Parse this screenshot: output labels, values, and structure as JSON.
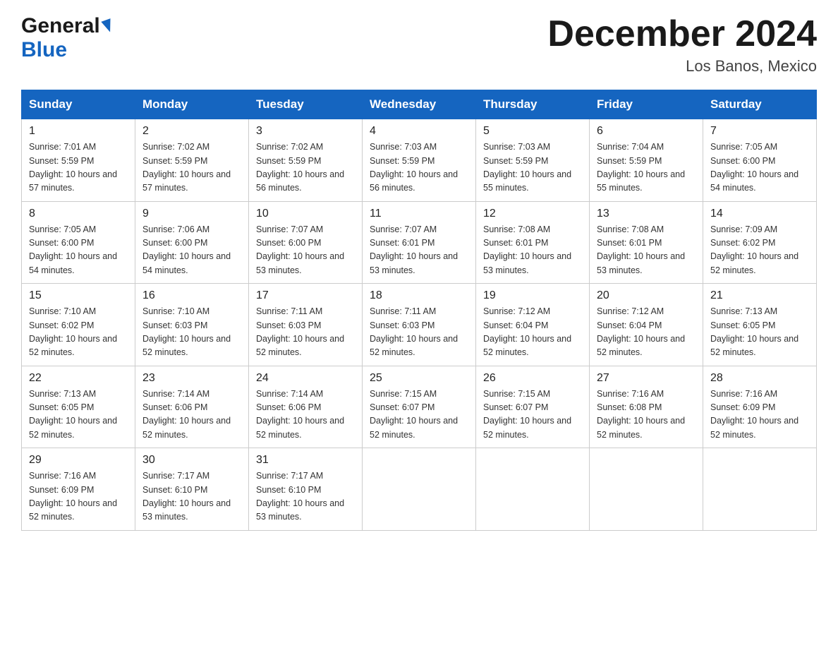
{
  "header": {
    "title": "December 2024",
    "location": "Los Banos, Mexico",
    "logo_general": "General",
    "logo_blue": "Blue"
  },
  "days_of_week": [
    "Sunday",
    "Monday",
    "Tuesday",
    "Wednesday",
    "Thursday",
    "Friday",
    "Saturday"
  ],
  "weeks": [
    [
      {
        "day": "1",
        "sunrise": "7:01 AM",
        "sunset": "5:59 PM",
        "daylight": "10 hours and 57 minutes."
      },
      {
        "day": "2",
        "sunrise": "7:02 AM",
        "sunset": "5:59 PM",
        "daylight": "10 hours and 57 minutes."
      },
      {
        "day": "3",
        "sunrise": "7:02 AM",
        "sunset": "5:59 PM",
        "daylight": "10 hours and 56 minutes."
      },
      {
        "day": "4",
        "sunrise": "7:03 AM",
        "sunset": "5:59 PM",
        "daylight": "10 hours and 56 minutes."
      },
      {
        "day": "5",
        "sunrise": "7:03 AM",
        "sunset": "5:59 PM",
        "daylight": "10 hours and 55 minutes."
      },
      {
        "day": "6",
        "sunrise": "7:04 AM",
        "sunset": "5:59 PM",
        "daylight": "10 hours and 55 minutes."
      },
      {
        "day": "7",
        "sunrise": "7:05 AM",
        "sunset": "6:00 PM",
        "daylight": "10 hours and 54 minutes."
      }
    ],
    [
      {
        "day": "8",
        "sunrise": "7:05 AM",
        "sunset": "6:00 PM",
        "daylight": "10 hours and 54 minutes."
      },
      {
        "day": "9",
        "sunrise": "7:06 AM",
        "sunset": "6:00 PM",
        "daylight": "10 hours and 54 minutes."
      },
      {
        "day": "10",
        "sunrise": "7:07 AM",
        "sunset": "6:00 PM",
        "daylight": "10 hours and 53 minutes."
      },
      {
        "day": "11",
        "sunrise": "7:07 AM",
        "sunset": "6:01 PM",
        "daylight": "10 hours and 53 minutes."
      },
      {
        "day": "12",
        "sunrise": "7:08 AM",
        "sunset": "6:01 PM",
        "daylight": "10 hours and 53 minutes."
      },
      {
        "day": "13",
        "sunrise": "7:08 AM",
        "sunset": "6:01 PM",
        "daylight": "10 hours and 53 minutes."
      },
      {
        "day": "14",
        "sunrise": "7:09 AM",
        "sunset": "6:02 PM",
        "daylight": "10 hours and 52 minutes."
      }
    ],
    [
      {
        "day": "15",
        "sunrise": "7:10 AM",
        "sunset": "6:02 PM",
        "daylight": "10 hours and 52 minutes."
      },
      {
        "day": "16",
        "sunrise": "7:10 AM",
        "sunset": "6:03 PM",
        "daylight": "10 hours and 52 minutes."
      },
      {
        "day": "17",
        "sunrise": "7:11 AM",
        "sunset": "6:03 PM",
        "daylight": "10 hours and 52 minutes."
      },
      {
        "day": "18",
        "sunrise": "7:11 AM",
        "sunset": "6:03 PM",
        "daylight": "10 hours and 52 minutes."
      },
      {
        "day": "19",
        "sunrise": "7:12 AM",
        "sunset": "6:04 PM",
        "daylight": "10 hours and 52 minutes."
      },
      {
        "day": "20",
        "sunrise": "7:12 AM",
        "sunset": "6:04 PM",
        "daylight": "10 hours and 52 minutes."
      },
      {
        "day": "21",
        "sunrise": "7:13 AM",
        "sunset": "6:05 PM",
        "daylight": "10 hours and 52 minutes."
      }
    ],
    [
      {
        "day": "22",
        "sunrise": "7:13 AM",
        "sunset": "6:05 PM",
        "daylight": "10 hours and 52 minutes."
      },
      {
        "day": "23",
        "sunrise": "7:14 AM",
        "sunset": "6:06 PM",
        "daylight": "10 hours and 52 minutes."
      },
      {
        "day": "24",
        "sunrise": "7:14 AM",
        "sunset": "6:06 PM",
        "daylight": "10 hours and 52 minutes."
      },
      {
        "day": "25",
        "sunrise": "7:15 AM",
        "sunset": "6:07 PM",
        "daylight": "10 hours and 52 minutes."
      },
      {
        "day": "26",
        "sunrise": "7:15 AM",
        "sunset": "6:07 PM",
        "daylight": "10 hours and 52 minutes."
      },
      {
        "day": "27",
        "sunrise": "7:16 AM",
        "sunset": "6:08 PM",
        "daylight": "10 hours and 52 minutes."
      },
      {
        "day": "28",
        "sunrise": "7:16 AM",
        "sunset": "6:09 PM",
        "daylight": "10 hours and 52 minutes."
      }
    ],
    [
      {
        "day": "29",
        "sunrise": "7:16 AM",
        "sunset": "6:09 PM",
        "daylight": "10 hours and 52 minutes."
      },
      {
        "day": "30",
        "sunrise": "7:17 AM",
        "sunset": "6:10 PM",
        "daylight": "10 hours and 53 minutes."
      },
      {
        "day": "31",
        "sunrise": "7:17 AM",
        "sunset": "6:10 PM",
        "daylight": "10 hours and 53 minutes."
      },
      null,
      null,
      null,
      null
    ]
  ]
}
